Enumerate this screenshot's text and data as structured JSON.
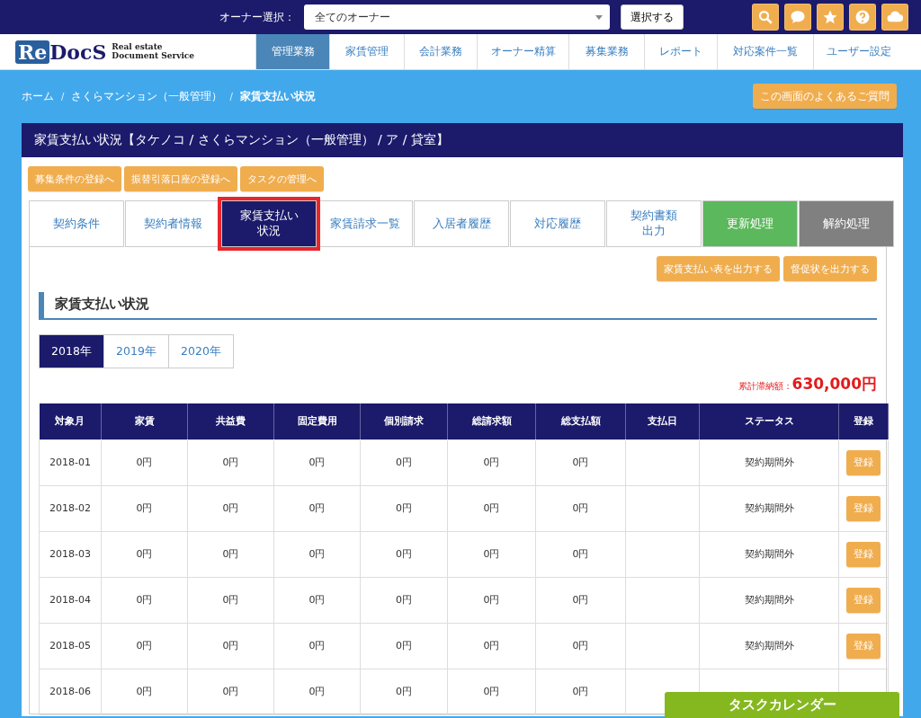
{
  "topbar": {
    "owner_label": "オーナー選択：",
    "owner_select": {
      "value": "全てのオーナー"
    },
    "select_button": "選択する"
  },
  "logo": {
    "mark": "Re",
    "name": "DocS",
    "tagline_1": "Real estate",
    "tagline_2": "Document Service"
  },
  "nav": [
    {
      "label": "管理業務",
      "selected": true
    },
    {
      "label": "家賃管理",
      "selected": false
    },
    {
      "label": "会計業務",
      "selected": false
    },
    {
      "label": "オーナー精算",
      "selected": false
    },
    {
      "label": "募集業務",
      "selected": false
    },
    {
      "label": "レポート",
      "selected": false
    },
    {
      "label": "対応案件一覧",
      "selected": false
    },
    {
      "label": "ユーザー設定",
      "selected": false
    }
  ],
  "breadcrumb_separator": "/",
  "breadcrumb": [
    {
      "label": "ホーム",
      "current": false
    },
    {
      "label": "さくらマンション（一般管理）",
      "current": false
    },
    {
      "label": "家賃支払い状況",
      "current": true
    }
  ],
  "faq_button": "この画面のよくあるご質問",
  "panel_title": "家賃支払い状況【タケノコ / さくらマンション（一般管理） / ア / 貸室】",
  "link_buttons": [
    "募集条件の登録へ",
    "振替引落口座の登録へ",
    "タスクの管理へ"
  ],
  "tabs": [
    {
      "label": "契約条件",
      "kind": "normal",
      "selected": false
    },
    {
      "label": "契約者情報",
      "kind": "normal",
      "selected": false
    },
    {
      "lines": [
        "家賃支払い",
        "状況"
      ],
      "kind": "normal",
      "selected": true
    },
    {
      "label": "家賃請求一覧",
      "kind": "normal",
      "selected": false
    },
    {
      "label": "入居者履歴",
      "kind": "normal",
      "selected": false
    },
    {
      "label": "対応履歴",
      "kind": "normal",
      "selected": false
    },
    {
      "lines": [
        "契約書類",
        "出力"
      ],
      "kind": "normal",
      "selected": false
    },
    {
      "label": "更新処理",
      "kind": "renew",
      "selected": false
    },
    {
      "label": "解約処理",
      "kind": "cancel",
      "selected": false
    }
  ],
  "output_buttons": [
    "家賃支払い表を出力する",
    "督促状を出力する"
  ],
  "section_title": "家賃支払い状況",
  "years": [
    {
      "label": "2018年",
      "selected": true
    },
    {
      "label": "2019年",
      "selected": false
    },
    {
      "label": "2020年",
      "selected": false
    }
  ],
  "arrears": {
    "label": "累計滞納額：",
    "value": "630,000円"
  },
  "table": {
    "columns": [
      "対象月",
      "家賃",
      "共益費",
      "固定費用",
      "個別請求",
      "総請求額",
      "総支払額",
      "支払日",
      "ステータス",
      "登録"
    ],
    "rows": [
      {
        "cells": [
          "2018-01",
          "0円",
          "0円",
          "0円",
          "0円",
          "0円",
          "0円",
          "",
          "契約期間外"
        ],
        "button": "登録"
      },
      {
        "cells": [
          "2018-02",
          "0円",
          "0円",
          "0円",
          "0円",
          "0円",
          "0円",
          "",
          "契約期間外"
        ],
        "button": "登録"
      },
      {
        "cells": [
          "2018-03",
          "0円",
          "0円",
          "0円",
          "0円",
          "0円",
          "0円",
          "",
          "契約期間外"
        ],
        "button": "登録"
      },
      {
        "cells": [
          "2018-04",
          "0円",
          "0円",
          "0円",
          "0円",
          "0円",
          "0円",
          "",
          "契約期間外"
        ],
        "button": "登録"
      },
      {
        "cells": [
          "2018-05",
          "0円",
          "0円",
          "0円",
          "0円",
          "0円",
          "0円",
          "",
          "契約期間外"
        ],
        "button": "登録"
      },
      {
        "cells": [
          "2018-06",
          "0円",
          "0円",
          "0円",
          "0円",
          "0円",
          "0円"
        ]
      }
    ]
  },
  "task_calendar": "タスクカレンダー"
}
